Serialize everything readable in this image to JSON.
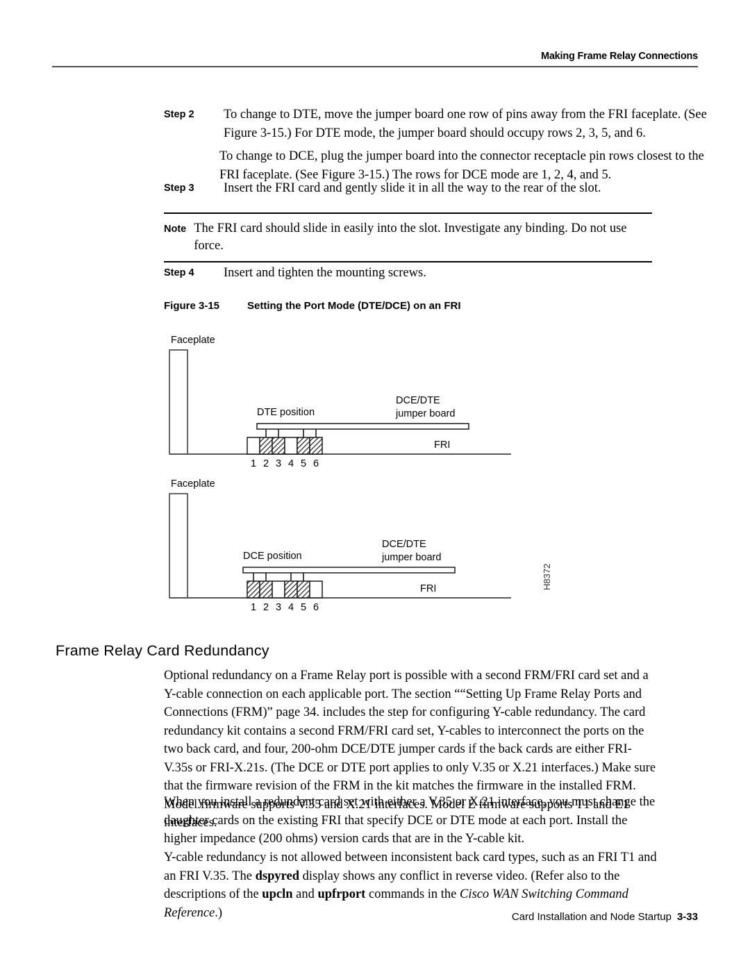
{
  "header": {
    "title": "Making Frame Relay Connections"
  },
  "steps": [
    {
      "label": "Step 2",
      "text": "To change to DTE, move the jumper board one row of pins away from the FRI faceplate. (See Figure 3-15.) For DTE mode, the jumper board should occupy rows 2, 3, 5, and 6."
    },
    {
      "label": "Step 3",
      "text": "Insert the FRI card and gently slide it in all the way to the rear of the slot."
    },
    {
      "label": "Step 4",
      "text": "Insert and tighten the mounting screws."
    }
  ],
  "step2_continuation": "To change to DCE, plug the jumper board into the connector receptacle pin rows closest to the FRI faceplate. (See Figure 3-15.) The rows for DCE mode are 1, 2, 4, and 5.",
  "note": {
    "label": "Note",
    "text": "The FRI card should slide in easily into the slot. Investigate any binding. Do not use force."
  },
  "figure": {
    "number": "Figure 3-15",
    "title": "Setting the Port Mode (DTE/DCE) on an FRI",
    "art_id": "H8372",
    "diagrams": [
      {
        "faceplate_label": "Faceplate",
        "position_label": "DTE position",
        "jumper_label_line1": "DCE/DTE",
        "jumper_label_line2": "jumper board",
        "card_label": "FRI",
        "pin_numbers": [
          "1",
          "2",
          "3",
          "4",
          "5",
          "6"
        ],
        "filled_pins": [
          2,
          3,
          5,
          6
        ]
      },
      {
        "faceplate_label": "Faceplate",
        "position_label": "DCE position",
        "jumper_label_line1": "DCE/DTE",
        "jumper_label_line2": "jumper board",
        "card_label": "FRI",
        "pin_numbers": [
          "1",
          "2",
          "3",
          "4",
          "5",
          "6"
        ],
        "filled_pins": [
          1,
          2,
          4,
          5
        ]
      }
    ]
  },
  "section": {
    "heading": "Frame Relay Card Redundancy",
    "paragraphs": [
      "Optional redundancy on a Frame Relay port is possible with a second FRM/FRI card set and a Y-cable connection on each applicable port. The section ““Setting Up Frame Relay Ports and Connections (FRM)” page 34. includes the step for configuring Y-cable redundancy. The card redundancy kit contains a second FRM/FRI card set, Y-cables to interconnect the ports on the two back card, and four, 200-ohm DCE/DTE jumper cards if the back cards are either FRI-V.35s or FRI-X.21s. (The DCE or DTE port applies to only V.35 or X.21 interfaces.) Make sure that the firmware revision of the FRM in the kit matches the firmware in the installed FRM. Model firmware supports V.35 and X.21 interfaces. Model E firmware supports T1 and E1 interfaces.",
      "When you install a redundant card set with either a V.35 or X.21 interface, you must change the daughter cards on the existing FRI that specify DCE or DTE mode at each port. Install the higher impedance (200 ohms) version cards that are in the Y-cable kit."
    ],
    "last_paragraph": {
      "part1": "Y-cable redundancy is not allowed between inconsistent back card types, such as an FRI T1 and an FRI V.35. The ",
      "bold1": "dspyred",
      "part2": " display shows any conflict in reverse video. (Refer also to the descriptions of the ",
      "bold2": "upcln",
      "part3": " and ",
      "bold3": "upfrport",
      "part4": " commands in the ",
      "italic1": "Cisco WAN Switching Command Reference",
      "part5": ".)"
    }
  },
  "footer": {
    "title": "Card Installation and Node Startup",
    "page_number": "3-33"
  }
}
